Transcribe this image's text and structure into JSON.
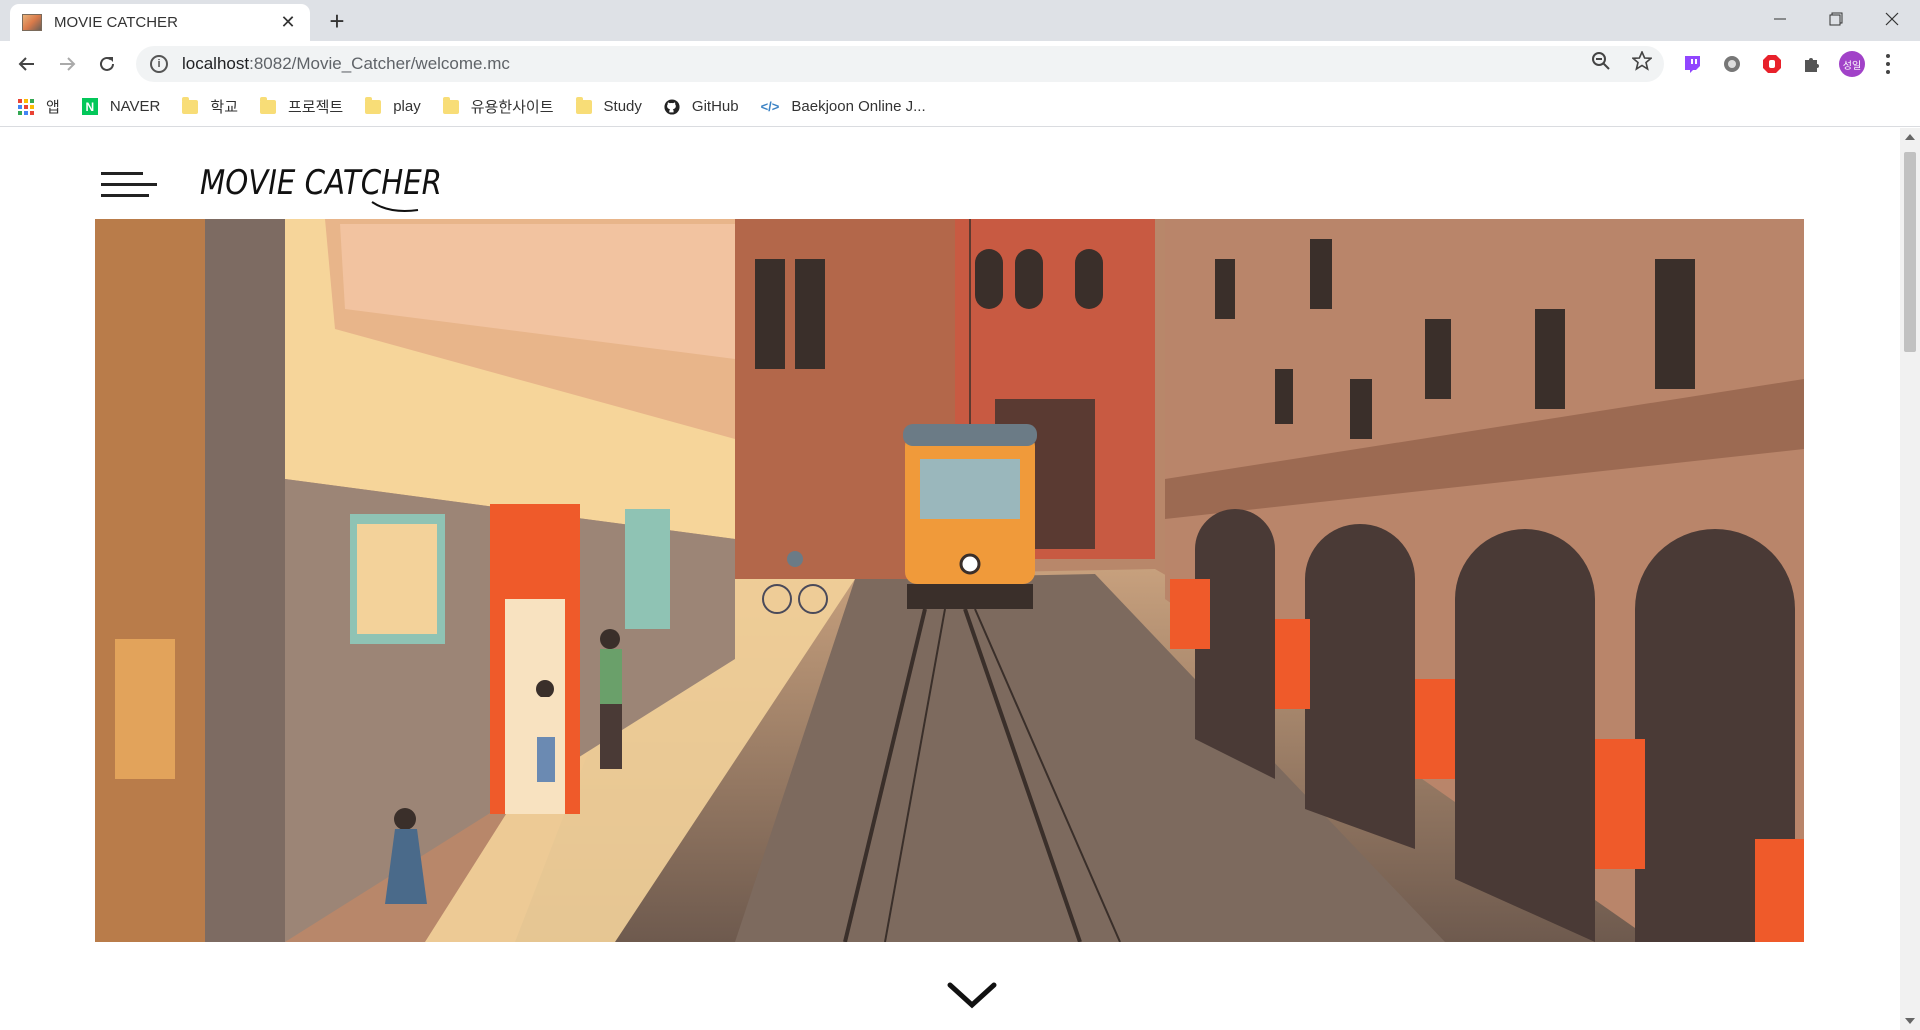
{
  "browser": {
    "tab_title": "MOVIE CATCHER",
    "tab_close": "✕",
    "new_tab": "+",
    "url_host": "localhost",
    "url_path": ":8082/Movie_Catcher/welcome.mc",
    "profile_initials": "성일",
    "window_controls": [
      "minimize",
      "restore",
      "close"
    ]
  },
  "bookmarks": [
    {
      "label": "앱",
      "icon": "apps-grid-icon"
    },
    {
      "label": "NAVER",
      "icon": "naver-icon"
    },
    {
      "label": "학교",
      "icon": "folder-icon"
    },
    {
      "label": "프로젝트",
      "icon": "folder-icon"
    },
    {
      "label": "play",
      "icon": "folder-icon"
    },
    {
      "label": "유용한사이트",
      "icon": "folder-icon"
    },
    {
      "label": "Study",
      "icon": "folder-icon"
    },
    {
      "label": "GitHub",
      "icon": "github-icon"
    },
    {
      "label": "Baekjoon Online J...",
      "icon": "code-icon"
    }
  ],
  "page": {
    "logo_text": "MOVIE CATCHER",
    "menu_icon": "hamburger-menu-icon",
    "hero_image": "illustrated-tram-street-scene",
    "scroll_down_icon": "chevron-down-icon"
  },
  "colors": {
    "sky": "#4a5a78",
    "building_yellow": "#f6d59a",
    "building_brown": "#b9856a",
    "tram_orange": "#f09a3a",
    "accent_red": "#f05a2a",
    "street": "#8a7060"
  }
}
